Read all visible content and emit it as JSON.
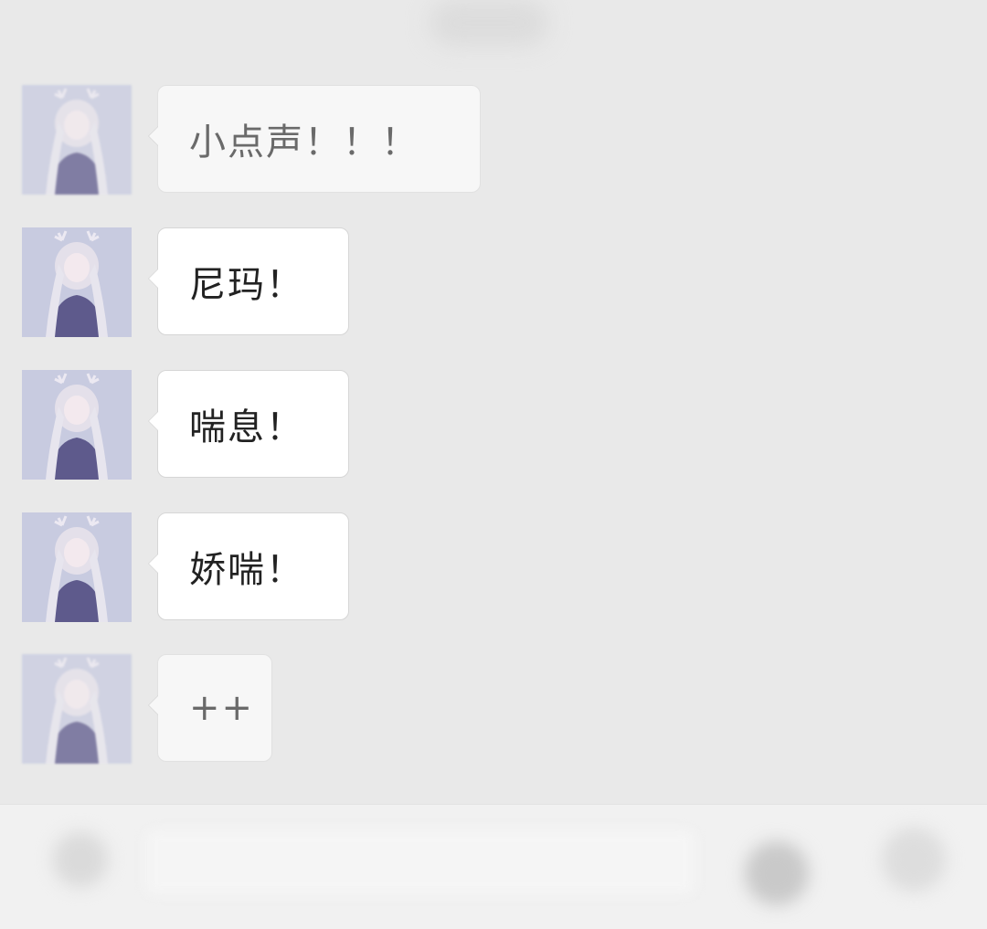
{
  "chat": {
    "messages": [
      {
        "sender": "avatar",
        "text": "小点声！！！",
        "faded": true
      },
      {
        "sender": "avatar",
        "text": "尼玛！",
        "faded": false
      },
      {
        "sender": "avatar",
        "text": "喘息！",
        "faded": false
      },
      {
        "sender": "avatar",
        "text": "娇喘！",
        "faded": false
      },
      {
        "sender": "avatar",
        "text": "++",
        "faded": true
      }
    ]
  },
  "bottom_bar": {
    "icons": [
      "voice-icon",
      "emoji-icon",
      "plus-icon"
    ]
  },
  "colors": {
    "background": "#e9e9e9",
    "bubble": "#ffffff",
    "text": "#222222"
  }
}
